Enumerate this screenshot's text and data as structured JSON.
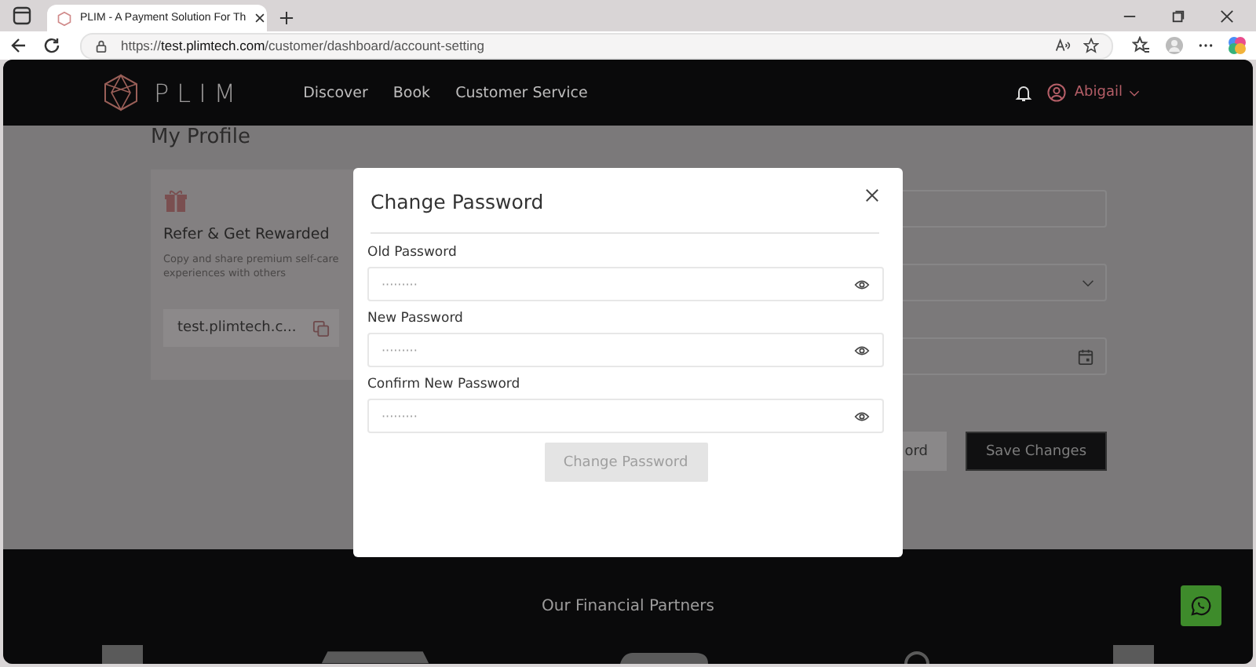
{
  "browser": {
    "tab_title": "PLIM - A Payment Solution For Th",
    "url_scheme": "https://",
    "url_host": "test.plimtech.com",
    "url_path": "/customer/dashboard/account-setting"
  },
  "nav": {
    "logo": "PLIM",
    "links": [
      "Discover",
      "Book",
      "Customer Service"
    ],
    "user": "Abigail"
  },
  "profile": {
    "heading": "My Profile",
    "refer_card": {
      "title": "Refer & Get Rewarded",
      "description": "Copy and share premium self-care experiences with others",
      "link": "test.plimtech.c..."
    },
    "buttons": [
      {
        "label": "ord",
        "kind": "secondary"
      },
      {
        "label": "Save Changes",
        "kind": "primary"
      }
    ]
  },
  "modal": {
    "title": "Change Password",
    "fields": [
      {
        "label": "Old Password",
        "placeholder": "·········"
      },
      {
        "label": "New Password",
        "placeholder": "·········"
      },
      {
        "label": "Confirm New Password",
        "placeholder": "·········"
      }
    ],
    "submit": {
      "label": "Change Password",
      "disabled": true
    }
  },
  "footer": {
    "heading": "Our Financial Partners"
  }
}
